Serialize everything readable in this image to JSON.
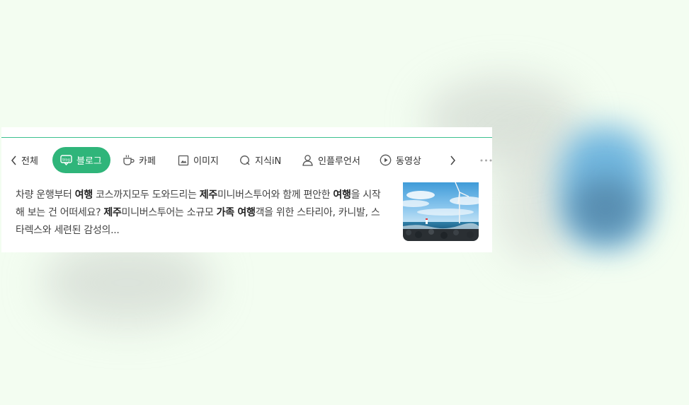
{
  "tabs": {
    "prev_label": "전체",
    "items": [
      {
        "label": "블로그",
        "icon": "blog-icon",
        "active": true
      },
      {
        "label": "카페",
        "icon": "cafe-cup-icon"
      },
      {
        "label": "이미지",
        "icon": "image-icon"
      },
      {
        "label": "지식iN",
        "icon": "search-q-icon"
      },
      {
        "label": "인플루언서",
        "icon": "person-icon"
      },
      {
        "label": "동영상",
        "icon": "play-icon"
      }
    ],
    "next_icon": "chevron-right-icon",
    "more_icon": "more-dots-icon"
  },
  "result": {
    "lines": [
      [
        {
          "t": "차량 운행부터 ",
          "b": false
        },
        {
          "t": "여행",
          "b": true
        },
        {
          "t": " 코스까지모두 도와드리는 ",
          "b": false
        },
        {
          "t": "제주",
          "b": true
        },
        {
          "t": "미니버스투어와 함께 편안한 ",
          "b": false
        },
        {
          "t": "여행",
          "b": true
        },
        {
          "t": "을 시작",
          "b": false
        }
      ],
      [
        {
          "t": "해 보는 건 어떠세요? ",
          "b": false
        },
        {
          "t": "제주",
          "b": true
        },
        {
          "t": "미니버스투어는 소규모 ",
          "b": false
        },
        {
          "t": "가족 여행",
          "b": true
        },
        {
          "t": "객을 위한 스타리아, 카니발, 스",
          "b": false
        }
      ],
      [
        {
          "t": "타렉스와 세련된 감성의...",
          "b": false
        }
      ]
    ],
    "thumbnail": "wind-turbine-seaside-photo"
  },
  "colors": {
    "accent": "#2fb57a",
    "accent_line": "#3cc08f",
    "background": "#f3fdf1"
  }
}
